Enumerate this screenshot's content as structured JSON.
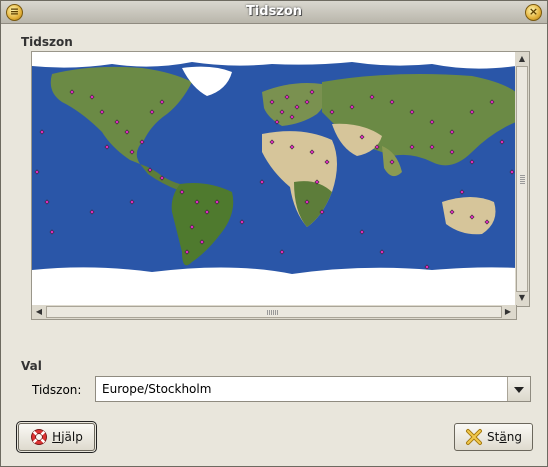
{
  "window": {
    "title": "Tidszon"
  },
  "map_section": {
    "title": "Tidszon"
  },
  "choice_section": {
    "title": "Val"
  },
  "timezone": {
    "label": "Tidszon:",
    "selected": "Europe/Stockholm"
  },
  "buttons": {
    "help": {
      "mnemonic": "H",
      "rest": "jälp"
    },
    "close": {
      "pre": "St",
      "mnemonic": "ä",
      "rest": "ng"
    }
  },
  "colors": {
    "ocean": "#2a56a8",
    "land": "#6b8a45",
    "desert": "#d6c59a",
    "ice": "#ffffff",
    "marker": "#e02cc0"
  },
  "icons": {
    "window_menu": "window-menu-icon",
    "window_close": "window-close-icon",
    "help": "lifebuoy-icon",
    "close": "close-x-icon"
  }
}
